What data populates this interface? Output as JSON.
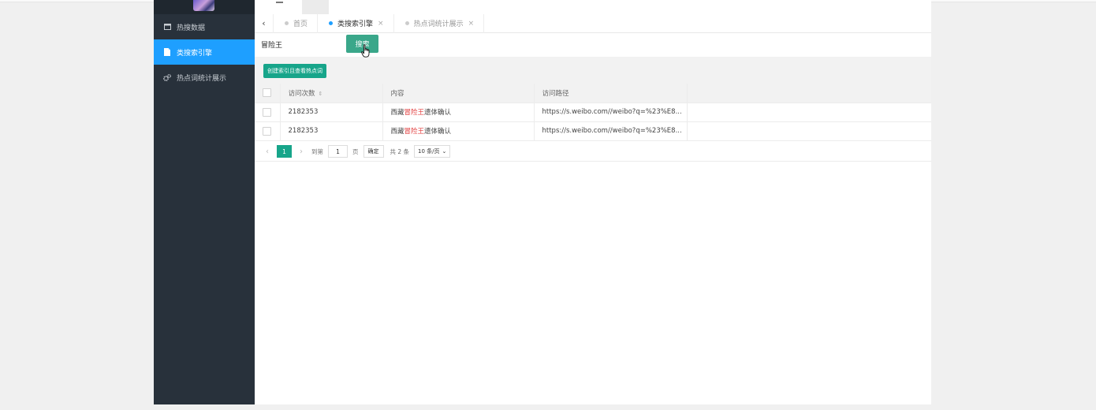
{
  "sidebar": {
    "items": [
      {
        "label": "热搜数据",
        "icon": "window-icon"
      },
      {
        "label": "类搜索引擎",
        "icon": "document-icon"
      },
      {
        "label": "热点词统计展示",
        "icon": "gears-icon"
      }
    ]
  },
  "tabs": {
    "items": [
      {
        "label": "首页"
      },
      {
        "label": "类搜索引擎",
        "close": "×"
      },
      {
        "label": "热点词统计展示",
        "close": "×"
      }
    ]
  },
  "search": {
    "value": "冒险王",
    "button_label": "搜索"
  },
  "toolbar": {
    "create_label": "创建索引且查看热点词"
  },
  "table": {
    "headers": [
      "访问次数",
      "内容",
      "访问路径"
    ],
    "rows": [
      {
        "count": "2182353",
        "content_prefix": "西藏",
        "content_highlight": "冒险王",
        "content_suffix": "遗体确认",
        "path": "https://s.weibo.com//weibo?q=%23%E8..."
      },
      {
        "count": "2182353",
        "content_prefix": "西藏",
        "content_highlight": "冒险王",
        "content_suffix": "遗体确认",
        "path": "https://s.weibo.com//weibo?q=%23%E8..."
      }
    ]
  },
  "pagination": {
    "current_page": "1",
    "goto_label": "到第",
    "goto_value": "1",
    "page_unit": "页",
    "confirm_label": "确定",
    "total_label": "共 2 条",
    "page_size_label": "10 条/页"
  },
  "colors": {
    "sidebar_bg": "#28313b",
    "active_blue": "#1e9fff",
    "green": "#17a58a",
    "highlight_red": "#e23c3c"
  }
}
